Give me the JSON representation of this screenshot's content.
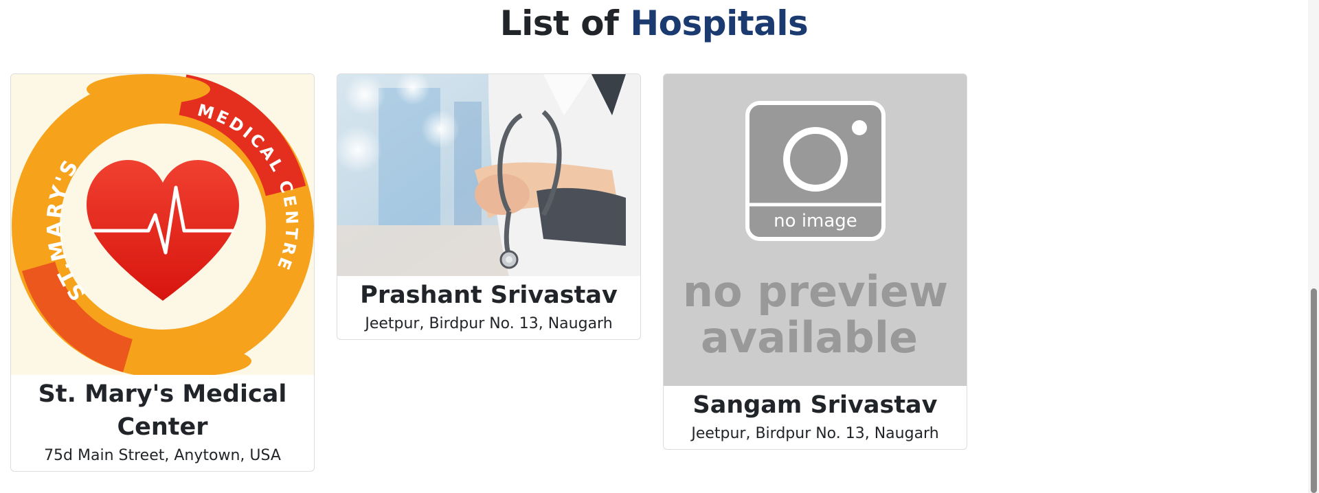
{
  "heading": {
    "prefix": "List of",
    "accent": "Hospitals",
    "accent_color": "#1b3a70"
  },
  "hospitals": [
    {
      "name": "St. Mary's Medical Center",
      "address": "75d Main Street, Anytown, USA",
      "image_icon": "st-marys-logo-icon",
      "logo_text_left": "ST.MARY'S",
      "logo_text_right": "MEDICAL CENTRE"
    },
    {
      "name": "Prashant Srivastav",
      "address": "Jeetpur, Birdpur No. 13, Naugarh",
      "image_icon": "doctor-stethoscope-photo"
    },
    {
      "name": "Sangam Srivastav",
      "address": "Jeetpur, Birdpur No. 13, Naugarh",
      "image_icon": "no-image-placeholder-icon",
      "placeholder_label": "no image",
      "placeholder_line1": "no preview",
      "placeholder_line2": "available"
    }
  ]
}
